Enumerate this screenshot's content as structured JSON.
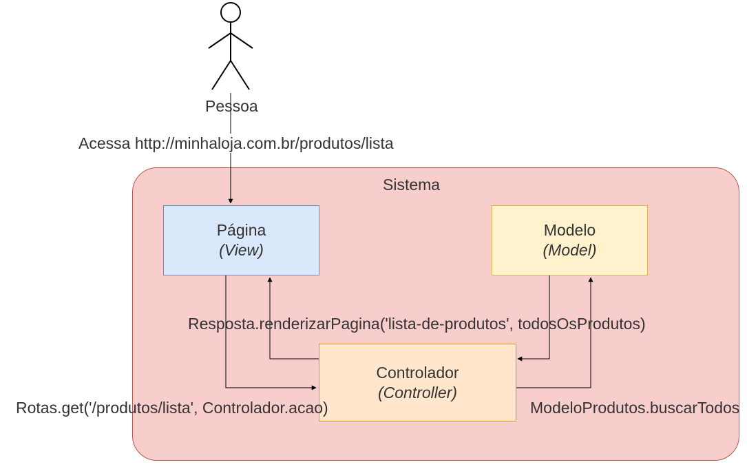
{
  "actor": {
    "label": "Pessoa"
  },
  "action": {
    "label": "Acessa http://minhaloja.com.br/produtos/lista"
  },
  "system": {
    "title": "Sistema"
  },
  "nodes": {
    "view": {
      "title": "Página",
      "subtitle": "(View)"
    },
    "model": {
      "title": "Modelo",
      "subtitle": "(Model)"
    },
    "controller": {
      "title": "Controlador",
      "subtitle": "(Controller)"
    }
  },
  "edges": {
    "view_to_ctrl": "Rotas.get('/produtos/lista', Controlador.acao)",
    "ctrl_to_view": "Resposta.renderizarPagina('lista-de-produtos', todosOsProdutos)",
    "model_to_ctrl": "ModeloProdutos.buscarTodos"
  }
}
